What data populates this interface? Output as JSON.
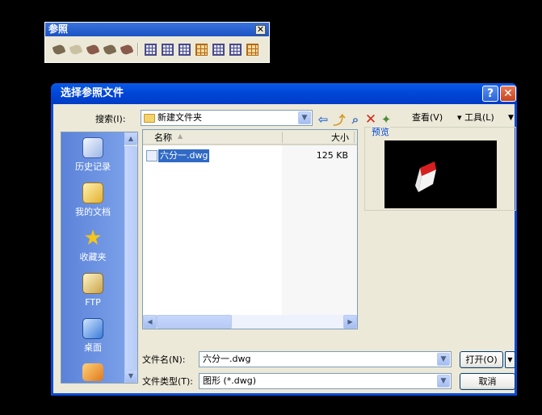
{
  "reference_toolbar": {
    "title": "参照",
    "close_glyph": "✕",
    "tools": [
      "attach-reference-icon",
      "attach-image-icon",
      "clip-reference-icon",
      "clip-image-icon",
      "reference-manager-icon",
      "image-frame-icon",
      "image-quality-icon",
      "image-transparency-icon",
      "xref-frame-icon",
      "underlay-frame-icon",
      "dwf-underlay-icon",
      "highlight-frame-icon"
    ]
  },
  "dialog": {
    "title": "选择参照文件",
    "help_glyph": "?",
    "close_glyph": "✕",
    "search_label": "搜索(I):",
    "search_value": "新建文件夹",
    "views_label": "查看(V)",
    "tools_label": "▾ 工具(L)",
    "places": [
      {
        "label": "历史记录",
        "icon": "history-icon"
      },
      {
        "label": "我的文档",
        "icon": "my-documents-icon"
      },
      {
        "label": "收藏夹",
        "icon": "favorites-icon"
      },
      {
        "label": "FTP",
        "icon": "ftp-icon"
      },
      {
        "label": "桌面",
        "icon": "desktop-icon"
      },
      {
        "label": "",
        "icon": "buzzsaw-icon"
      }
    ],
    "columns": {
      "name": "名称",
      "size": "大小"
    },
    "files": [
      {
        "name": "六分一.dwg",
        "size": "125 KB"
      }
    ],
    "preview_label": "预览",
    "filename_label": "文件名(N):",
    "filename_value": "六分一.dwg",
    "filetype_label": "文件类型(T):",
    "filetype_value": "图形 (*.dwg)",
    "open_label": "打开(O)",
    "cancel_label": "取消"
  }
}
